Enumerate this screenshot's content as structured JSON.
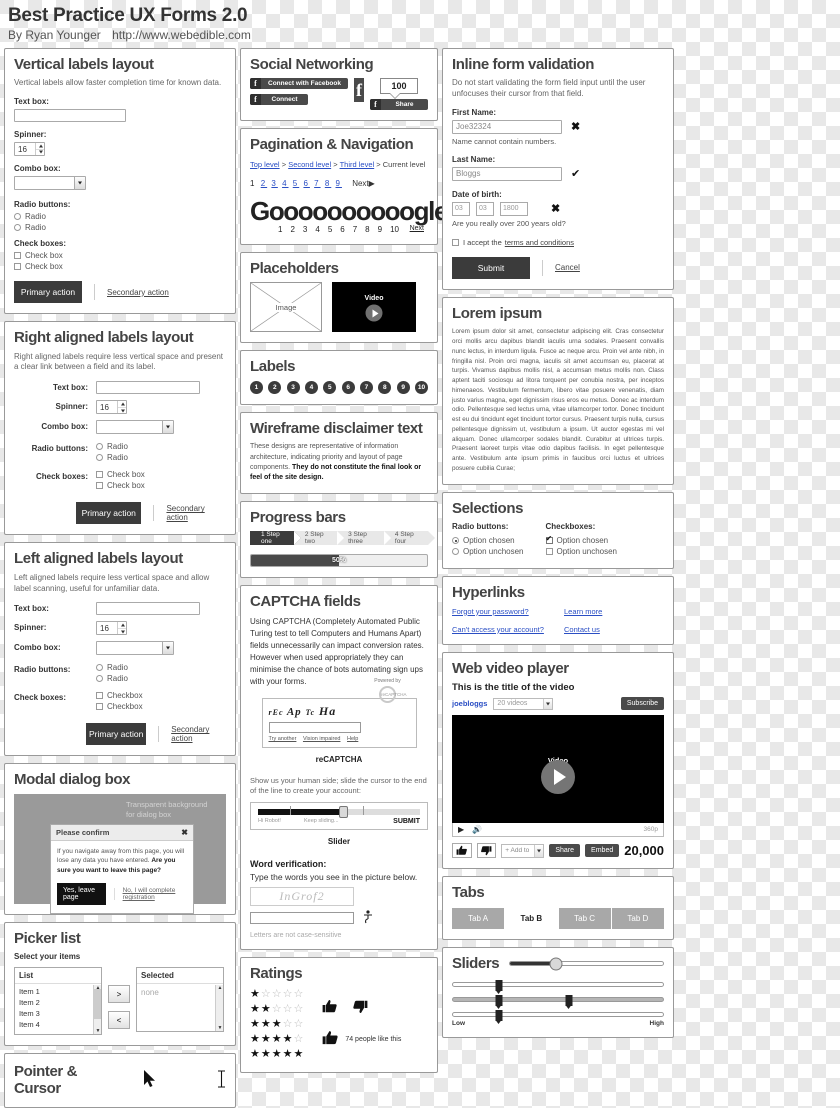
{
  "header": {
    "title": "Best Practice UX Forms 2.0",
    "byline": "By Ryan Younger",
    "url": "http://www.webedible.com"
  },
  "vertical_labels": {
    "title": "Vertical labels layout",
    "desc": "Vertical labels allow faster completion time for known data.",
    "textbox_label": "Text box:",
    "spinner_label": "Spinner:",
    "spinner_value": "16",
    "combo_label": "Combo box:",
    "radio_label": "Radio buttons:",
    "radio1": "Radio",
    "radio2": "Radio",
    "check_label": "Check boxes:",
    "check1": "Check box",
    "check2": "Check box",
    "primary": "Primary action",
    "secondary": "Secondary action"
  },
  "right_aligned": {
    "title": "Right aligned labels layout",
    "desc": "Right aligned labels require less vertical space and present a clear link between a field and its label.",
    "textbox_label": "Text box:",
    "spinner_label": "Spinner:",
    "spinner_value": "16",
    "combo_label": "Combo box:",
    "radio_label": "Radio buttons:",
    "radio1": "Radio",
    "radio2": "Radio",
    "check_label": "Check boxes:",
    "check1": "Check box",
    "check2": "Check box",
    "primary": "Primary action",
    "secondary": "Secondary action"
  },
  "left_aligned": {
    "title": "Left aligned labels layout",
    "desc": "Left aligned labels require less vertical space and allow label scanning, useful for unfamiliar data.",
    "textbox_label": "Text box:",
    "spinner_label": "Spinner:",
    "spinner_value": "16",
    "combo_label": "Combo box:",
    "radio_label": "Radio buttons:",
    "radio1": "Radio",
    "radio2": "Radio",
    "check_label": "Check boxes:",
    "check1": "Checkbox",
    "check2": "Checkbox",
    "primary": "Primary action",
    "secondary": "Secondary action"
  },
  "modal": {
    "title": "Modal dialog box",
    "stage_note": "Transparent background for dialog box",
    "dialog_title": "Please confirm",
    "close": "✖",
    "body_normal": "If you navigate away from this page, you will lose any data you have entered.  ",
    "body_bold": "Are you sure you want to leave this page?",
    "confirm": "Yes, leave page",
    "cancel": "No, I will complete registration"
  },
  "picker": {
    "title": "Picker list",
    "subtitle": "Select your items",
    "list_header": "List",
    "items": [
      "Item 1",
      "Item 2",
      "Item 3",
      "Item 4"
    ],
    "selected_header": "Selected",
    "selected_none": "none",
    "add_label": ">",
    "remove_label": "<"
  },
  "pointer": {
    "title": "Pointer & Cursor"
  },
  "social": {
    "title": "Social Networking",
    "connect_with_facebook": "Connect with Facebook",
    "connect": "Connect",
    "f_glyph": "f",
    "count": "100",
    "share": "Share"
  },
  "pagination": {
    "title": "Pagination & Navigation",
    "crumbs": [
      "Top level",
      "Second level",
      "Third level",
      "Current level"
    ],
    "crumb_sep": ">",
    "pages": [
      "1",
      "2",
      "3",
      "4",
      "5",
      "6",
      "7",
      "8",
      "9"
    ],
    "current_page": "1",
    "next": "Next",
    "google_word": "Goooooooooogle",
    "google_nums": [
      "1",
      "2",
      "3",
      "4",
      "5",
      "6",
      "7",
      "8",
      "9",
      "10"
    ],
    "google_next": "Next"
  },
  "placeholders": {
    "title": "Placeholders",
    "image_label": "Image",
    "video_label": "Video"
  },
  "labels": {
    "title": "Labels",
    "badges": [
      "1",
      "2",
      "3",
      "4",
      "5",
      "6",
      "7",
      "8",
      "9",
      "10"
    ]
  },
  "disclaimer": {
    "title": "Wireframe disclaimer text",
    "text_normal": "These designs are representative of information architecture, indicating priority and layout of page components.  ",
    "text_bold": "They do not constitute the final look or feel of the site design."
  },
  "progress": {
    "title": "Progress bars",
    "steps": [
      "1 Step one",
      "2 Step two",
      "3 Step three",
      "4 Step four"
    ],
    "active_step": 0,
    "percent_label": "50%",
    "percent_value": 50
  },
  "captcha": {
    "title": "CAPTCHA fields",
    "desc": "Using CAPTCHA (Completely Automated Public Turing test to tell Computers and Humans Apart) fields unnecessarily can impact conversion rates.  However when used appropriately they can minimise the chance of bots automating sign ups with your forms.",
    "words_1": "rEc",
    "words_2": "Ap",
    "words_3": "Tc",
    "words_4": "Ha",
    "powered_by": "Powered by",
    "ring_label": "reCAPTCHA",
    "links": [
      "Try another",
      "Vision impaired",
      "Help"
    ],
    "name": "reCAPTCHA",
    "slider_desc": "Show us your human side; slide the cursor to the end of the line to create your account:",
    "slider_left": "Hi Robot!",
    "slider_mid": "Keep sliding...",
    "slider_submit": "SUBMIT",
    "slider_name": "Slider",
    "word_verification_title": "Word verification:",
    "word_verification_sub": "Type the words you see in the picture below.",
    "word_image": "InGrof2",
    "word_note": "Letters are not case-sensitive"
  },
  "ratings": {
    "title": "Ratings",
    "rows": [
      {
        "filled": 1,
        "total": 5
      },
      {
        "filled": 2,
        "total": 5
      },
      {
        "filled": 3,
        "total": 5
      },
      {
        "filled": 4,
        "total": 5
      },
      {
        "filled": 5,
        "total": 5
      }
    ],
    "likes_text": "74 people like this"
  },
  "inline_validation": {
    "title": "Inline form validation",
    "desc": "Do not start validating the form field input until the user unfocuses their cursor from that field.",
    "first_name_label": "First Name:",
    "first_name_value": "Joe32324",
    "first_name_error": "Name cannot contain numbers.",
    "last_name_label": "Last Name:",
    "last_name_value": "Bloggs",
    "dob_label": "Date of birth:",
    "dob_day": "03",
    "dob_month": "03",
    "dob_year": "1800",
    "dob_error": "Are you really over 200 years old?",
    "terms_prefix": "I accept the",
    "terms_link": "terms and conditions",
    "submit": "Submit",
    "cancel": "Cancel"
  },
  "lorem": {
    "title": "Lorem ipsum",
    "body": "Lorem ipsum dolor sit amet, consectetur adipiscing elit. Cras consectetur orci mollis arcu dapibus blandit iaculis urna sodales. Praesent convallis nunc lectus, in interdum ligula. Fusce ac neque arcu. Proin vel ante nibh, in fringilla nisl. Proin orci magna, iaculis sit amet accumsan eu, placerat at turpis. Vivamus dapibus mollis nisl, a accumsan metus mollis non. Class aptent taciti sociosqu ad litora torquent per conubia nostra, per inceptos himenaeos. Vestibulum fermentum, libero vitae posuere venenatis, diam justo varius magna, eget dignissim risus eros eu metus. Donec ac interdum odio. Pellentesque sed lectus urna, vitae ullamcorper tortor. Donec tincidunt est eu dui tincidunt eget tincidunt tortor cursus. Praesent turpis nulla, cursus pellentesque dignissim ut, vestibulum a ipsum. Ut auctor egestas mi vel aliquam. Donec ullamcorper sodales blandit. Curabitur at ultrices turpis. Praesent laoreet turpis vitae odio dapibus facilisis. In eget pellentesque ante. Vestibulum ante ipsum primis in faucibus orci luctus et ultrices posuere cubilia Curae;"
  },
  "selections": {
    "title": "Selections",
    "radio_header": "Radio buttons:",
    "radio_chosen": "Option chosen",
    "radio_unchosen": "Option unchosen",
    "check_header": "Checkboxes:",
    "check_chosen": "Option chosen",
    "check_unchosen": "Option unchosen"
  },
  "hyperlinks": {
    "title": "Hyperlinks",
    "links": [
      "Forgot your password?",
      "Learn more",
      "Can't access your account?",
      "Contact us"
    ]
  },
  "video_player": {
    "title": "Web video player",
    "video_title": "This is the title of the video",
    "user": "joebloggs",
    "videos_select": "20 videos",
    "subscribe": "Subscribe",
    "screen_label": "Video",
    "quality": "360p",
    "add_to": "+ Add to",
    "share": "Share",
    "embed": "Embed",
    "view_count": "20,000"
  },
  "tabs": {
    "title": "Tabs",
    "items": [
      "Tab A",
      "Tab B",
      "Tab C",
      "Tab D"
    ],
    "active": 1
  },
  "sliders": {
    "title": "Sliders",
    "low_label": "Low",
    "high_label": "High",
    "values": [
      30,
      22,
      22,
      22
    ],
    "second_handle": 55
  },
  "colors": {
    "dark": "#3b3b3b",
    "link": "#2a4ec4",
    "grey": "#a8a8a8"
  }
}
